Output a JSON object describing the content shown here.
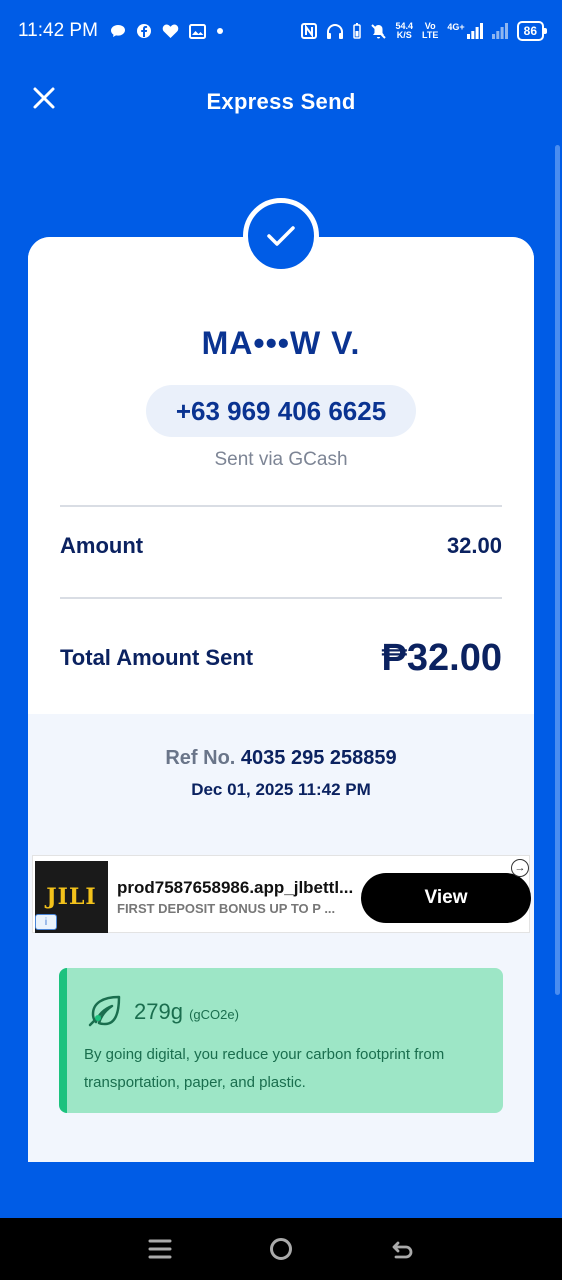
{
  "status_bar": {
    "time": "11:42 PM",
    "left_icons": [
      "message-bubble-icon",
      "facebook-icon",
      "heart-icon",
      "gallery-icon",
      "dot-icon"
    ],
    "net_speed": "54.4",
    "net_speed_unit": "K/S",
    "volte_top": "Vo",
    "volte_bottom": "LTE",
    "network_type": "4G+",
    "battery_level": "86"
  },
  "header": {
    "title": "Express Send",
    "close_icon": "close-icon"
  },
  "receipt": {
    "recipient_name": "MA•••W V.",
    "phone": "+63 969 406 6625",
    "sent_via": "Sent via GCash",
    "amount_label": "Amount",
    "amount_value": "32.00",
    "total_label": "Total Amount Sent",
    "total_value": "₱32.00",
    "ref_label": "Ref No.",
    "ref_value": "4035 295 258859",
    "date": "Dec 01, 2025 11:42 PM"
  },
  "ad": {
    "logo_text": "JILI",
    "title": "prod7587658986.app_jlbettl...",
    "subtitle": "FIRST DEPOSIT BONUS UP TO P ...",
    "button_label": "View",
    "info_label": "i",
    "choice_label": "→"
  },
  "carbon": {
    "value": "279g",
    "unit": "(gCO2e)",
    "text": "By going digital, you reduce your carbon footprint from transportation, paper, and plastic.",
    "icon": "leaf-icon"
  },
  "colors": {
    "brand_blue": "#005ce6",
    "text_navy": "#0b2260",
    "carbon_bg": "#9de6c6",
    "carbon_accent": "#1cc27e"
  }
}
